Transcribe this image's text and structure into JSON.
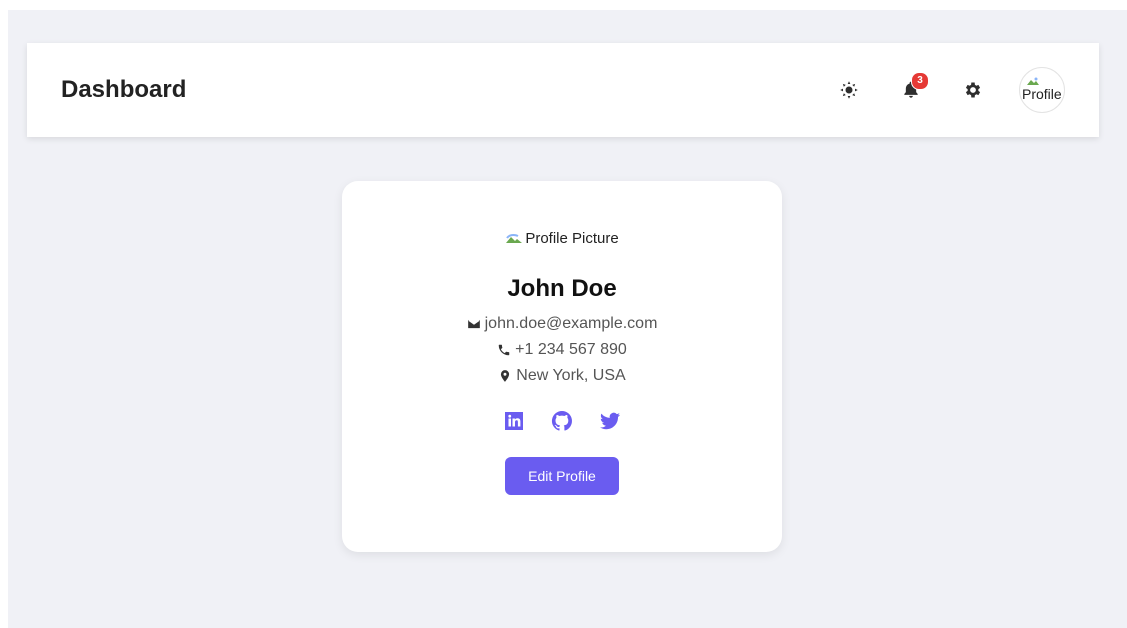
{
  "header": {
    "title": "Dashboard",
    "icons": [
      "sun-icon",
      "bell-icon",
      "gear-icon"
    ],
    "notifications_count": "3",
    "avatar_alt": "Profile"
  },
  "profile": {
    "picture_alt": "Profile Picture",
    "name": "John Doe",
    "email": "john.doe@example.com",
    "phone": "+1 234 567 890",
    "location": "New York, USA",
    "social_icons": [
      "linkedin-icon",
      "github-icon",
      "twitter-icon"
    ],
    "edit_label": "Edit Profile"
  },
  "colors": {
    "accent": "#6a5cf0",
    "badge": "#e53935",
    "background": "#f0f1f6",
    "text": "#222222"
  }
}
